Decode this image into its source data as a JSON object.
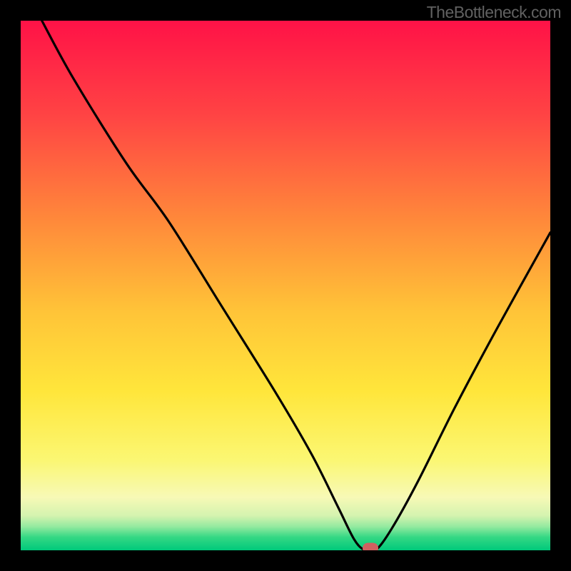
{
  "watermark": "TheBottleneck.com",
  "chart_data": {
    "type": "line",
    "title": "",
    "xlabel": "",
    "ylabel": "",
    "xlim": [
      0,
      100
    ],
    "ylim": [
      0,
      100
    ],
    "x": [
      4,
      10,
      20,
      28,
      38,
      48,
      55,
      60,
      63,
      65,
      67,
      70,
      75,
      82,
      90,
      100
    ],
    "values": [
      100,
      89,
      73,
      62,
      46,
      30,
      18,
      8,
      2,
      0,
      0,
      4,
      13,
      27,
      42,
      60
    ],
    "marker": {
      "x": 66,
      "y": 0
    },
    "gradient_stops": [
      {
        "offset": 0.0,
        "color": "#ff1247"
      },
      {
        "offset": 0.18,
        "color": "#ff4444"
      },
      {
        "offset": 0.38,
        "color": "#ff8a3a"
      },
      {
        "offset": 0.55,
        "color": "#ffc438"
      },
      {
        "offset": 0.7,
        "color": "#ffe63b"
      },
      {
        "offset": 0.83,
        "color": "#fbf773"
      },
      {
        "offset": 0.9,
        "color": "#f7f9b6"
      },
      {
        "offset": 0.935,
        "color": "#d4f3af"
      },
      {
        "offset": 0.955,
        "color": "#95eaa0"
      },
      {
        "offset": 0.975,
        "color": "#35d884"
      },
      {
        "offset": 1.0,
        "color": "#00c97b"
      }
    ]
  }
}
